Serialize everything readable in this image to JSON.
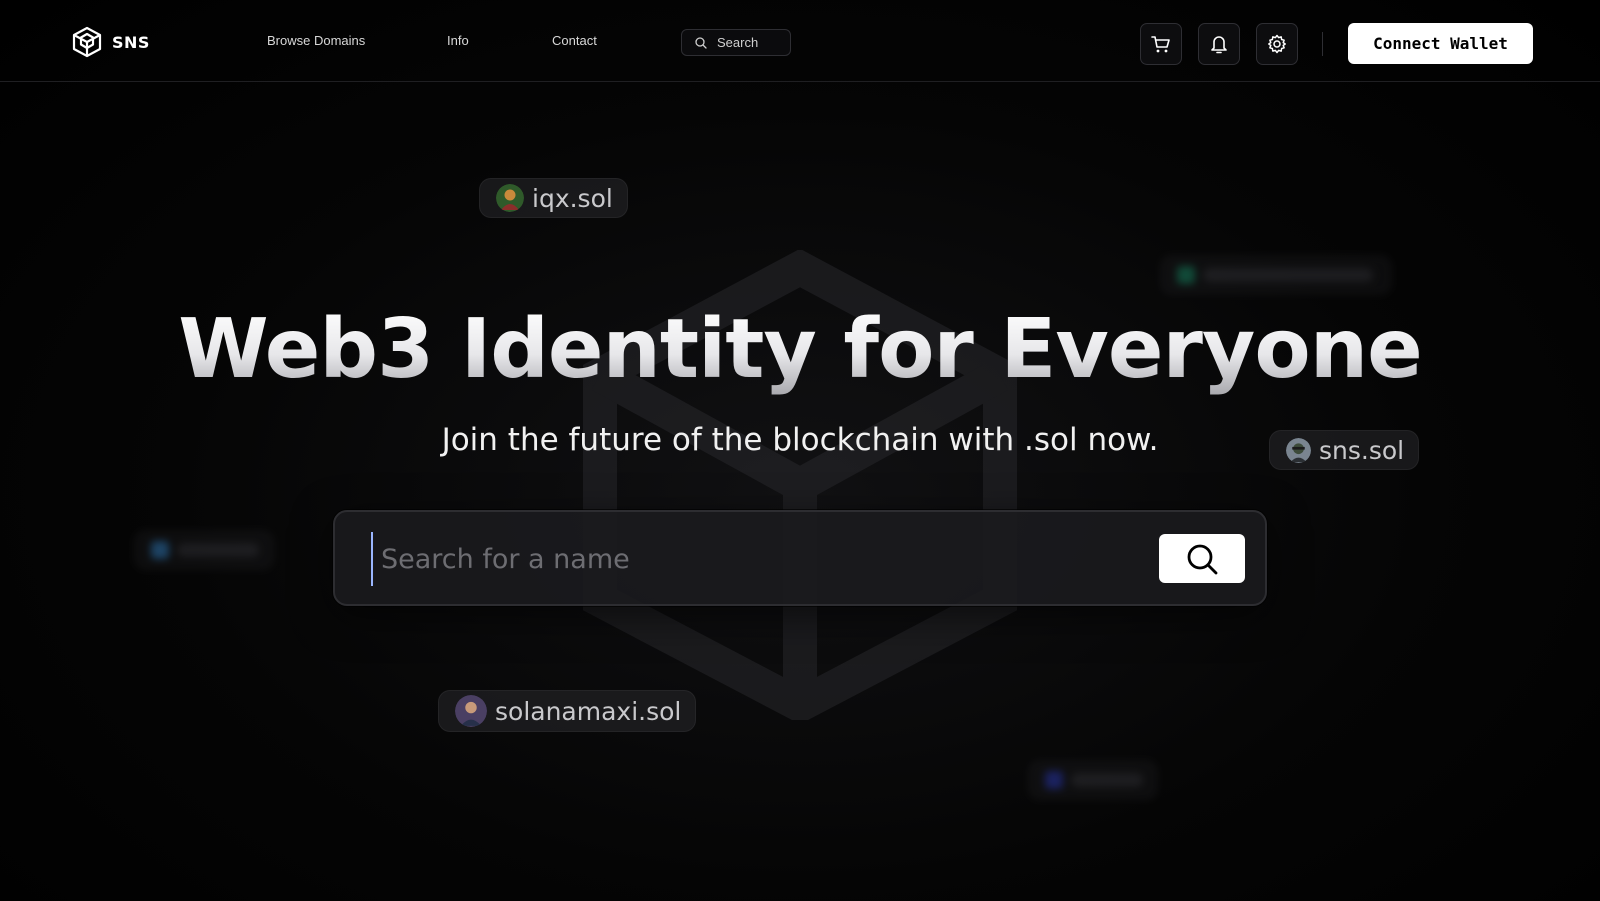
{
  "brand": {
    "name": "SNS"
  },
  "nav": {
    "links": [
      "Browse Domains",
      "Info",
      "Contact"
    ],
    "search_label": "Search",
    "icons": [
      "cart-icon",
      "bell-icon",
      "gear-icon"
    ],
    "connect_label": "Connect Wallet"
  },
  "hero": {
    "title": "Web3 Identity for Everyone",
    "subtitle": "Join the future of the blockchain with .sol now.",
    "search_placeholder": "Search for a name"
  },
  "chips": [
    {
      "label": "iqx.sol"
    },
    {
      "label": "sns.sol"
    },
    {
      "label": "solanamaxi.sol"
    }
  ],
  "colors": {
    "background": "#000000",
    "accent": "#ffffff",
    "border": "#2e2e33"
  }
}
